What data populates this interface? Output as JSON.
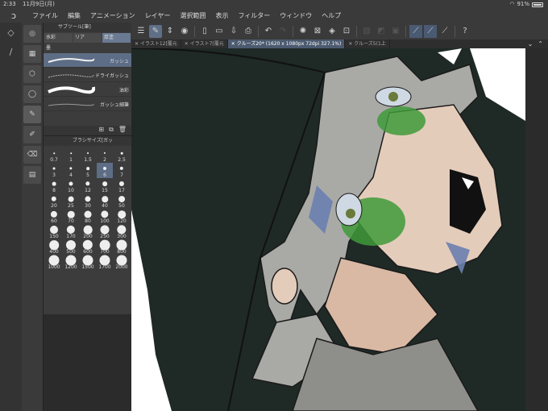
{
  "status": {
    "time": "2:33",
    "date": "11月9日(月)",
    "wifi": "wifi-icon",
    "battery": "91%"
  },
  "menu": [
    "ファイル",
    "編集",
    "アニメーション",
    "レイヤー",
    "選択範囲",
    "表示",
    "フィルター",
    "ウィンドウ",
    "ヘルプ"
  ],
  "tabs": [
    "イラスト12[覆元",
    "イラスト7[覆元",
    "クルーズ20* (1620 x 1080px 72dpi 327.1%)",
    "クルーズ5(1上"
  ],
  "subtool": {
    "header": "サブツール[筆]",
    "tabs": [
      "水彩",
      "リア",
      "厚塗"
    ],
    "row2": "墨",
    "brushes": [
      "ガッシュ",
      "ドライガッシュ",
      "油彩",
      "ガッシュ細筆"
    ]
  },
  "brushsize": {
    "header": "ブラシサイズ[ガッ",
    "sizes": [
      "0.7",
      "1",
      "1.5",
      "2",
      "2.5",
      "3",
      "4",
      "5",
      "6",
      "7",
      "8",
      "10",
      "12",
      "15",
      "17",
      "20",
      "25",
      "30",
      "40",
      "50",
      "60",
      "70",
      "80",
      "100",
      "120",
      "150",
      "170",
      "200",
      "250",
      "300",
      "400",
      "500",
      "600",
      "700",
      "800",
      "1000",
      "1200",
      "1500",
      "1700",
      "2000"
    ],
    "selected": "6"
  },
  "colors": {
    "accent": "#5d6d86",
    "hair": "#a9aaa6",
    "skin": "#e4ccbb",
    "hood": "#1f2a27",
    "eye_green": "#3f9a3a",
    "blue_shadow": "#6a7fb0"
  }
}
